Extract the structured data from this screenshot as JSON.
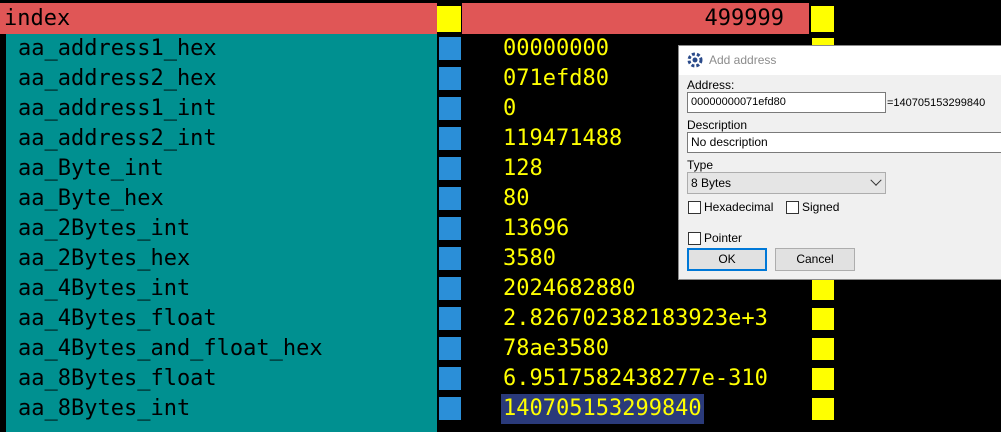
{
  "table": {
    "header": {
      "name": "index",
      "value": "499999"
    },
    "rows": [
      {
        "name": "aa_address1_hex",
        "value": "00000000"
      },
      {
        "name": "aa_address2_hex",
        "value": "071efd80"
      },
      {
        "name": "aa_address1_int",
        "value": "0"
      },
      {
        "name": "aa_address2_int",
        "value": "119471488"
      },
      {
        "name": "aa_Byte_int",
        "value": "128"
      },
      {
        "name": "aa_Byte_hex",
        "value": "80"
      },
      {
        "name": "aa_2Bytes_int",
        "value": "13696"
      },
      {
        "name": "aa_2Bytes_hex",
        "value": "3580"
      },
      {
        "name": "aa_4Bytes_int",
        "value": "2024682880"
      },
      {
        "name": "aa_4Bytes_float",
        "value": "2.826702382183923e+3"
      },
      {
        "name": "aa_4Bytes_and_float_hex",
        "value": "78ae3580"
      },
      {
        "name": "aa_8Bytes_float",
        "value": "6.9517582438277e-310"
      },
      {
        "name": "aa_8Bytes_int",
        "value": "140705153299840",
        "selected": true
      }
    ]
  },
  "dialog": {
    "title": "Add address",
    "address_label": "Address:",
    "address_value": "00000000071efd80",
    "address_result": "=140705153299840",
    "description_label": "Description",
    "description_value": "No description",
    "type_label": "Type",
    "type_value": "8 Bytes",
    "hexadecimal_label": "Hexadecimal",
    "signed_label": "Signed",
    "pointer_label": "Pointer",
    "ok_label": "OK",
    "cancel_label": "Cancel"
  },
  "colors": {
    "header_bg": "#e05656",
    "name_bg": "#009090",
    "value_text": "#ffff00",
    "marker_blue": "#2b8fd8",
    "marker_yellow": "#ffff00",
    "selection": "#2a3a7a"
  },
  "icons": {
    "dialog_icon": "cheat-engine-gear-icon"
  }
}
